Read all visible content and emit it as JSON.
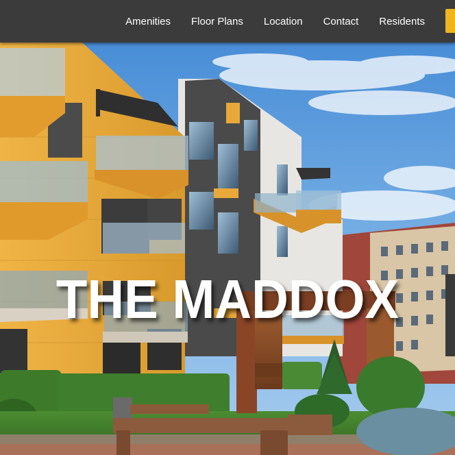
{
  "nav": {
    "links": [
      {
        "label": "Amenities"
      },
      {
        "label": "Floor Plans"
      },
      {
        "label": "Location"
      },
      {
        "label": "Contact"
      },
      {
        "label": "Residents"
      }
    ]
  },
  "hero": {
    "title": "THE MADDOX"
  },
  "colors": {
    "nav_background": "#3b3b3b",
    "accent": "#f0b41c",
    "sky": "#4f93d8",
    "building_yellow": "#e8a93a"
  }
}
